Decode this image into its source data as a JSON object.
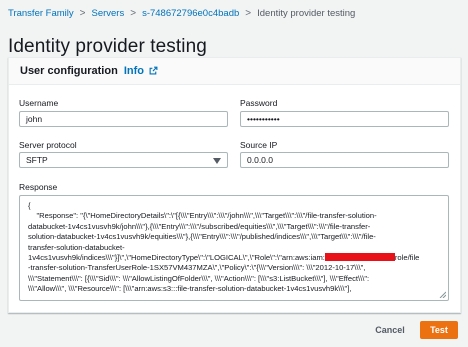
{
  "breadcrumb": {
    "items": [
      "Transfer Family",
      "Servers",
      "s-748672796e0c4badb"
    ],
    "current": "Identity provider testing",
    "separator": ">"
  },
  "page": {
    "title": "Identity provider testing"
  },
  "config": {
    "title": "User configuration",
    "info_label": "Info",
    "username": {
      "label": "Username",
      "value": "john"
    },
    "password": {
      "label": "Password",
      "value": "•••••••••••"
    },
    "protocol": {
      "label": "Server protocol",
      "value": "SFTP"
    },
    "source_ip": {
      "label": "Source IP",
      "value": "0.0.0.0"
    },
    "response": {
      "label": "Response",
      "line1": "{",
      "line2": "    \"Response\": \"{\\\"HomeDirectoryDetails\\\":\\\"[{\\\\\\\"Entry\\\\\\\":\\\\\\\"/john\\\\\\\",\\\\\\\"Target\\\\\\\":\\\\\\\"/file-transfer-solution-",
      "line3": "databucket-1v4cs1vusvh9k/john\\\\\\\"},{\\\\\\\"Entry\\\\\\\":\\\\\\\"/subscribed/equities\\\\\\\",\\\\\\\"Target\\\\\\\":\\\\\\\"/file-transfer-",
      "line4": "solution-databucket-1v4cs1vusvh9k/equities\\\\\\\"},{\\\\\\\"Entry\\\\\\\":\\\\\\\"/published/indices\\\\\\\",\\\\\\\"Target\\\\\\\":\\\\\\\"/file-",
      "line5": "transfer-solution-databucket-",
      "line6": "1v4cs1vusvh9k/indices\\\\\\\"}]\\\",\\\"HomeDirectoryType\\\":\\\"LOGICAL\\\",\\\"Role\\\":\\\"arn:aws:iam:",
      "line6b": "role/file",
      "line7": "-transfer-solution-TransferUserRole-1SX57VM437MZA\\\",\\\"Policy\\\":\\\"{\\\\\\\"Version\\\\\\\": \\\\\\\"2012-10-17\\\\\\\",",
      "line8": "\\\\\\\"Statement\\\\\\\": [{\\\\\\\"Sid\\\\\\\": \\\\\\\"AllowListingOfFolder\\\\\\\", \\\\\\\"Action\\\\\\\": [\\\\\\\"s3:ListBucket\\\\\\\"], \\\\\\\"Effect\\\\\\\":",
      "line9": "\\\\\\\"Allow\\\\\\\", \\\\\\\"Resource\\\\\\\": [\\\\\\\"arn:aws:s3:::file-transfer-solution-databucket-1v4cs1vusvh9k\\\\\\\"],"
    }
  },
  "actions": {
    "cancel": "Cancel",
    "test": "Test"
  },
  "colors": {
    "link": "#0073bb",
    "primary_button": "#ec7211",
    "redaction": "#e8111a",
    "background": "#f2f3f3"
  },
  "icons": [
    "external-link-icon",
    "chevron-down-icon",
    "resize-handle-icon"
  ]
}
